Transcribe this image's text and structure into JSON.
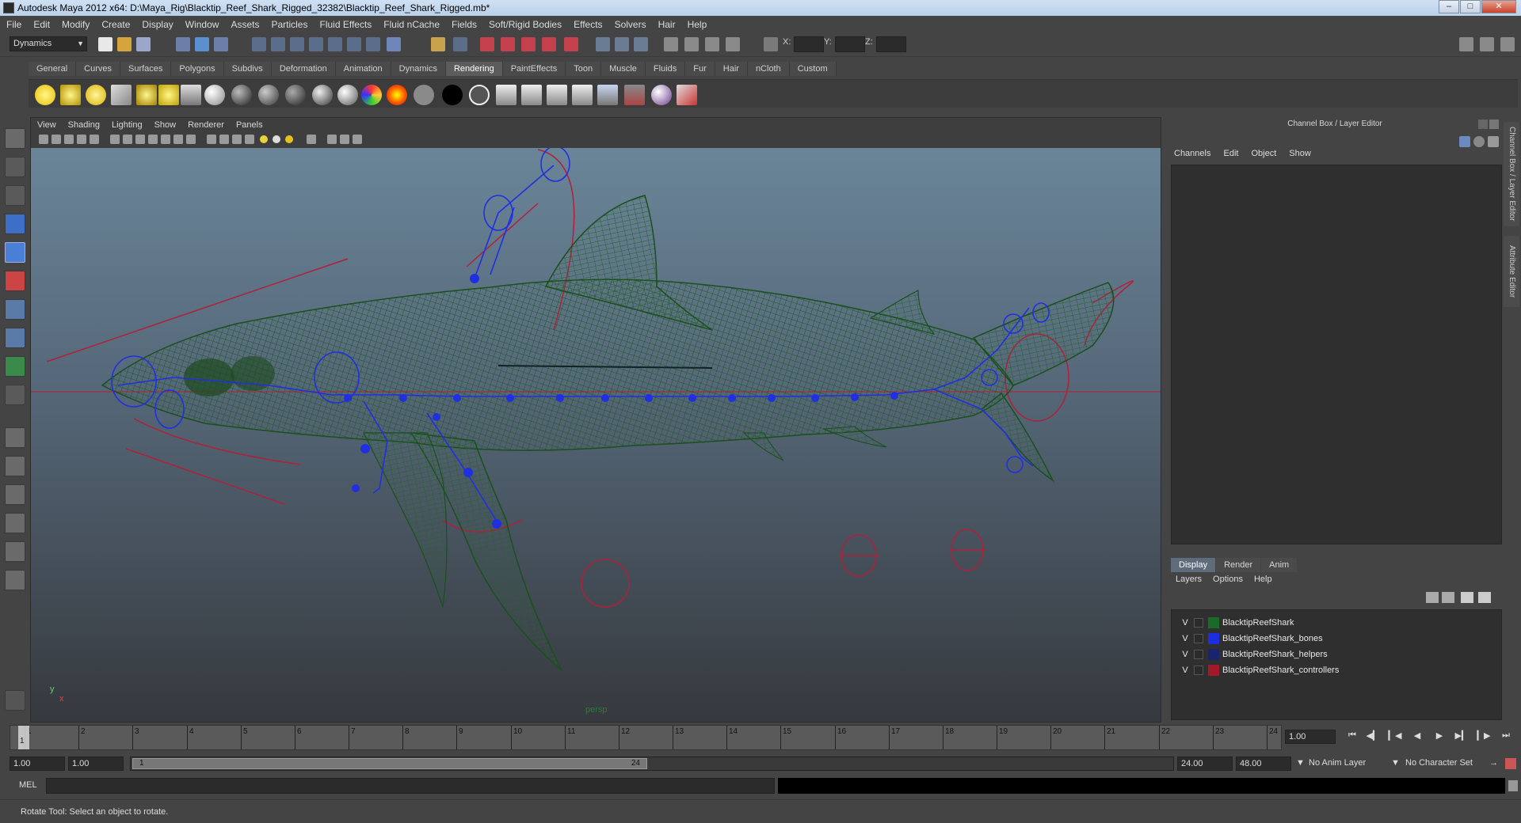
{
  "window": {
    "title": "Autodesk Maya 2012 x64: D:\\Maya_Rig\\Blacktip_Reef_Shark_Rigged_32382\\Blacktip_Reef_Shark_Rigged.mb*",
    "minimize_icon": "minimize-icon",
    "maximize_icon": "maximize-icon",
    "close_icon": "close-icon"
  },
  "menubar": [
    "File",
    "Edit",
    "Modify",
    "Create",
    "Display",
    "Window",
    "Assets",
    "Particles",
    "Fluid Effects",
    "Fluid nCache",
    "Fields",
    "Soft/Rigid Bodies",
    "Effects",
    "Solvers",
    "Hair",
    "Help"
  ],
  "statusline": {
    "mode": "Dynamics",
    "x_label": "X:",
    "y_label": "Y:",
    "z_label": "Z:"
  },
  "shelf": {
    "tabs": [
      "General",
      "Curves",
      "Surfaces",
      "Polygons",
      "Subdivs",
      "Deformation",
      "Animation",
      "Dynamics",
      "Rendering",
      "PaintEffects",
      "Toon",
      "Muscle",
      "Fluids",
      "Fur",
      "Hair",
      "nCloth",
      "Custom"
    ],
    "active_tab": "Rendering"
  },
  "viewport": {
    "menu": [
      "View",
      "Shading",
      "Lighting",
      "Show",
      "Renderer",
      "Panels"
    ],
    "camera_label": "persp",
    "axis_y": "y",
    "axis_x": "x"
  },
  "channel_box": {
    "title": "Channel Box / Layer Editor",
    "menu": [
      "Channels",
      "Edit",
      "Object",
      "Show"
    ]
  },
  "side_tabs": [
    "Channel Box / Layer Editor",
    "Attribute Editor"
  ],
  "layer_editor": {
    "tabs": [
      "Display",
      "Render",
      "Anim"
    ],
    "active_tab": "Display",
    "menu": [
      "Layers",
      "Options",
      "Help"
    ],
    "layers": [
      {
        "visible": "V",
        "name": "BlacktipReefShark",
        "color": "#1a6b2a"
      },
      {
        "visible": "V",
        "name": "BlacktipReefShark_bones",
        "color": "#1c2ee0"
      },
      {
        "visible": "V",
        "name": "BlacktipReefShark_helpers",
        "color": "#18246e"
      },
      {
        "visible": "V",
        "name": "BlacktipReefShark_controllers",
        "color": "#a01a2c"
      }
    ]
  },
  "timeline": {
    "ticks": [
      "1",
      "2",
      "3",
      "4",
      "5",
      "6",
      "7",
      "8",
      "9",
      "10",
      "11",
      "12",
      "13",
      "14",
      "15",
      "16",
      "17",
      "18",
      "19",
      "20",
      "21",
      "22",
      "23",
      "24"
    ],
    "current_marker": "1",
    "current_frame": "1.00"
  },
  "range": {
    "start_time": "1.00",
    "playback_start": "1.00",
    "range_start_label": "1",
    "range_end_label": "24",
    "playback_end": "24.00",
    "end_time": "48.00",
    "anim_layer": "No Anim Layer",
    "character_set": "No Character Set"
  },
  "cmdline": {
    "label": "MEL"
  },
  "helpline": {
    "text": "Rotate Tool: Select an object to rotate."
  },
  "colors": {
    "wireframe_mesh": "#1f5a22",
    "bones": "#2030e0",
    "controllers": "#b0203a"
  }
}
